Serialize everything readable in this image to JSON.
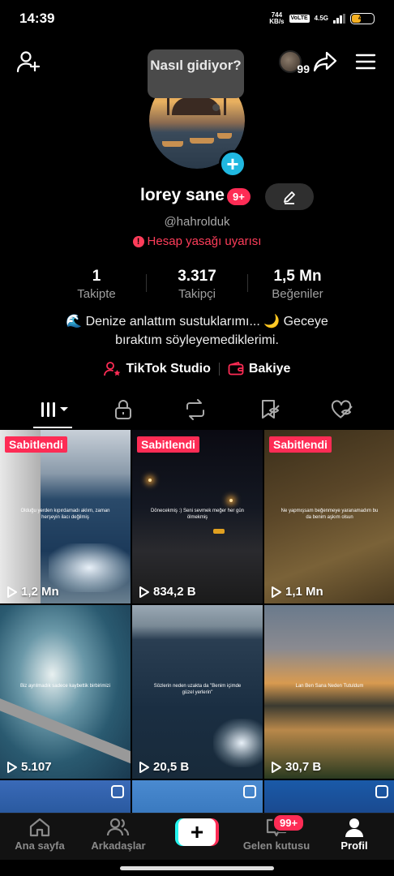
{
  "status_bar": {
    "time": "14:39",
    "net_speed": "744",
    "net_unit": "KB/s",
    "volte": "VoLTE",
    "network": "4.5G",
    "battery": "43"
  },
  "top_bar": {
    "story_count": "99"
  },
  "bubble": {
    "text": "Nasıl gidiyor?"
  },
  "profile": {
    "name": "lorey sane",
    "badge": "9+",
    "handle": "@hahrolduk",
    "warning": "Hesap yasağı uyarısı",
    "stats": [
      {
        "value": "1",
        "label": "Takipte"
      },
      {
        "value": "3.317",
        "label": "Takipçi"
      },
      {
        "value": "1,5 Mn",
        "label": "Beğeniler"
      }
    ],
    "bio_line1": "🌊 Denize anlattım sustuklarımı... 🌙 Geceye",
    "bio_line2": "bıraktım söyleyemediklerimi.",
    "links": {
      "studio": "TikTok Studio",
      "balance": "Bakiye"
    }
  },
  "videos": [
    {
      "pinned": "Sabitlendi",
      "views": "1,2 Mn",
      "caption": "Olduğu yerden kıpırdamadı aklım, zaman herşeyin ilacı değilmiş"
    },
    {
      "pinned": "Sabitlendi",
      "views": "834,2 B",
      "caption": "Dönecekmiş :) Seni sevmek meğer her gün ölmekmiş"
    },
    {
      "pinned": "Sabitlendi",
      "views": "1,1 Mn",
      "caption": "Ne yapmışsam beğenmeye yaranamadım bu da benim aşkım olsun"
    },
    {
      "pinned": "",
      "views": "5.107",
      "caption": "Biz ayrılmadık sadece kaybettik birbirimizi"
    },
    {
      "pinned": "",
      "views": "20,5 B",
      "caption": "Sözlerin neden uzakta da \"Benim içimde güzel yerlerin\""
    },
    {
      "pinned": "",
      "views": "30,7 B",
      "caption": "Lan Ben Sana Neden Tutuldum"
    }
  ],
  "bottom_nav": {
    "home": "Ana sayfa",
    "friends": "Arkadaşlar",
    "create": "+",
    "inbox": "Gelen kutusu",
    "inbox_badge": "99+",
    "profile": "Profil"
  },
  "colors": {
    "accent": "#fe2c55",
    "warning": "#fe3d5a",
    "cyan": "#25f4ee"
  }
}
